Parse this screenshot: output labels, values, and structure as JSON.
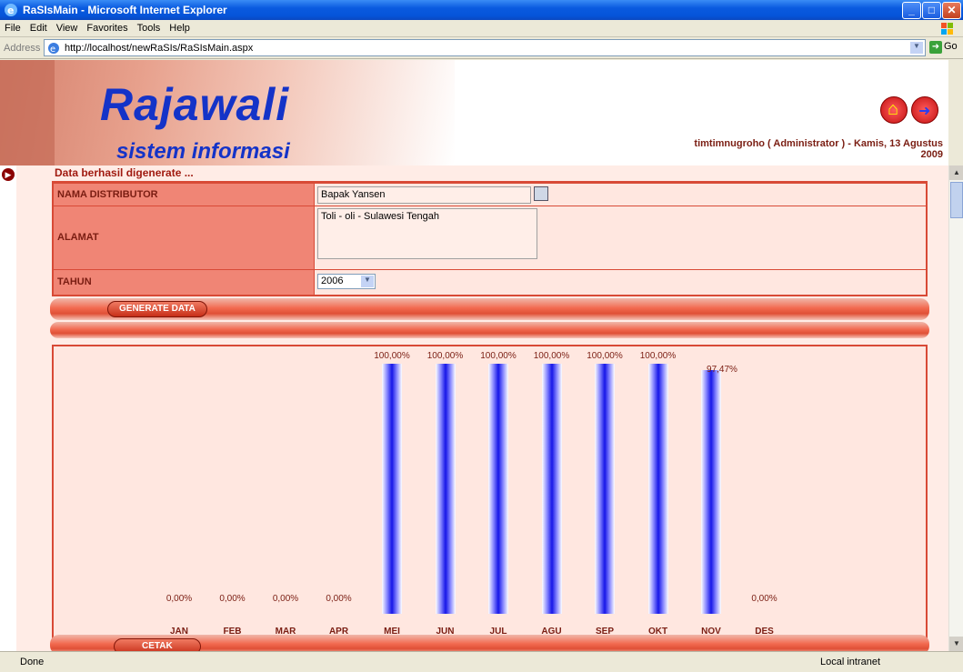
{
  "window": {
    "title": "RaSIsMain - Microsoft Internet Explorer"
  },
  "menu": [
    "File",
    "Edit",
    "View",
    "Favorites",
    "Tools",
    "Help"
  ],
  "address": {
    "label": "Address",
    "url": "http://localhost/newRaSIs/RaSIsMain.aspx",
    "go": "Go"
  },
  "header": {
    "logo_main": "Rajawali",
    "logo_sub": "sistem informasi",
    "user_line1": "timtimnugroho ( Administrator ) - Kamis, 13 Agustus",
    "user_line2": "2009"
  },
  "message": "Data berhasil digenerate ...",
  "form": {
    "distributor_label": "NAMA DISTRIBUTOR",
    "distributor_value": "Bapak Yansen",
    "address_label": "ALAMAT",
    "address_value": "Toli - oli - Sulawesi Tengah",
    "year_label": "TAHUN",
    "year_value": "2006",
    "generate_button": "GENERATE DATA"
  },
  "chart_data": {
    "type": "bar",
    "categories": [
      "JAN",
      "FEB",
      "MAR",
      "APR",
      "MEI",
      "JUN",
      "JUL",
      "AGU",
      "SEP",
      "OKT",
      "NOV",
      "DES"
    ],
    "values": [
      0,
      0,
      0,
      0,
      100,
      100,
      100,
      100,
      100,
      100,
      97.47,
      0
    ],
    "value_labels": [
      "0,00%",
      "0,00%",
      "0,00%",
      "0,00%",
      "100,00%",
      "100,00%",
      "100,00%",
      "100,00%",
      "100,00%",
      "100,00%",
      "97,47%",
      "0,00%"
    ],
    "ylim": [
      0,
      100
    ]
  },
  "print_button": "CETAK",
  "status": {
    "left": "Done",
    "zone": "Local intranet"
  }
}
